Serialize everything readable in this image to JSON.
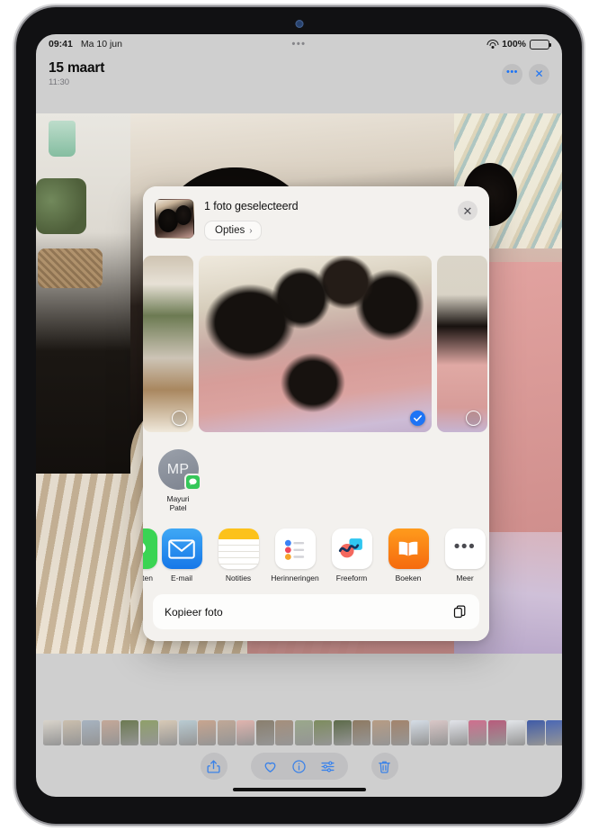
{
  "status_bar": {
    "time": "09:41",
    "date": "Ma 10 jun",
    "dots": "•••",
    "battery_percent": "100%",
    "wifi_icon": "wifi-icon",
    "battery_icon": "battery-icon"
  },
  "nav_bar": {
    "title": "15 maart",
    "subtitle": "11:30",
    "more_label": "•••",
    "close_label": "✕"
  },
  "share_sheet": {
    "title": "1 foto geselecteerd",
    "options_label": "Opties",
    "options_chevron": "›",
    "close_label": "✕",
    "thumbnail_name": "selected-photo-thumbnail",
    "photos": [
      {
        "name": "photo-previous",
        "selected": false,
        "position": "side"
      },
      {
        "name": "photo-main-selected",
        "selected": true,
        "position": "main"
      },
      {
        "name": "photo-next",
        "selected": false,
        "position": "side"
      }
    ],
    "contacts": [
      {
        "initials": "MP",
        "name": "Mayuri\nPatel",
        "name_line1": "Mayuri",
        "name_line2": "Patel",
        "badge_icon": "messages-badge-icon"
      }
    ],
    "apps": [
      {
        "label": "Berichten",
        "icon": "messages-icon",
        "clipped": true
      },
      {
        "label": "E-mail",
        "icon": "mail-icon",
        "clipped": false
      },
      {
        "label": "Notities",
        "icon": "notes-icon",
        "clipped": false
      },
      {
        "label": "Herinneringen",
        "icon": "reminders-icon",
        "clipped": false
      },
      {
        "label": "Freeform",
        "icon": "freeform-icon",
        "clipped": false
      },
      {
        "label": "Boeken",
        "icon": "books-icon",
        "clipped": false
      },
      {
        "label": "Meer",
        "icon": "more-icon",
        "clipped": false
      }
    ],
    "actions": [
      {
        "label": "Kopieer foto",
        "icon": "copy-icon"
      }
    ]
  },
  "bottom_toolbar": {
    "share_icon": "share-icon",
    "favorite_icon": "heart-icon",
    "info_icon": "info-icon",
    "adjust_icon": "adjust-icon",
    "delete_icon": "trash-icon"
  },
  "colors": {
    "accent_blue": "#1d74f5",
    "toolbar_blue": "#3b82e8",
    "sheet_background": "#f3f1ee",
    "badge_green": "#35c759",
    "screen_background": "#cfcfcf"
  },
  "filmstrip": {
    "name": "photo-filmstrip",
    "thumbs": [
      "#d9d4cb",
      "#cbbfae",
      "#a7b3c0",
      "#c4a898",
      "#6c7a52",
      "#8fa06a",
      "#d7c9b6",
      "#b9cbd2",
      "#c8a58f",
      "#c0a897",
      "#e0b4ae",
      "#8a7f6e",
      "#a58f7c",
      "#9aa88b",
      "#7d8c5e",
      "#5d6b4a",
      "#8e7a62",
      "#b79c84",
      "#a3846c",
      "#d5dde6",
      "#d9c7c7",
      "#e2e4ea",
      "#cf6f8e",
      "#b85c7c",
      "#e3e6ea",
      "#3f5ba8",
      "#4a67b5",
      "#2f4f9e",
      "#e8eaef",
      "#e9ebef",
      "#2d4f8c",
      "#3a5fa0",
      "#23406f",
      "#1d3a66",
      "#2a4f8f",
      "#234a86",
      "#1a2e55",
      "#3b5d96",
      "#141414",
      "#1d1d1d"
    ]
  }
}
